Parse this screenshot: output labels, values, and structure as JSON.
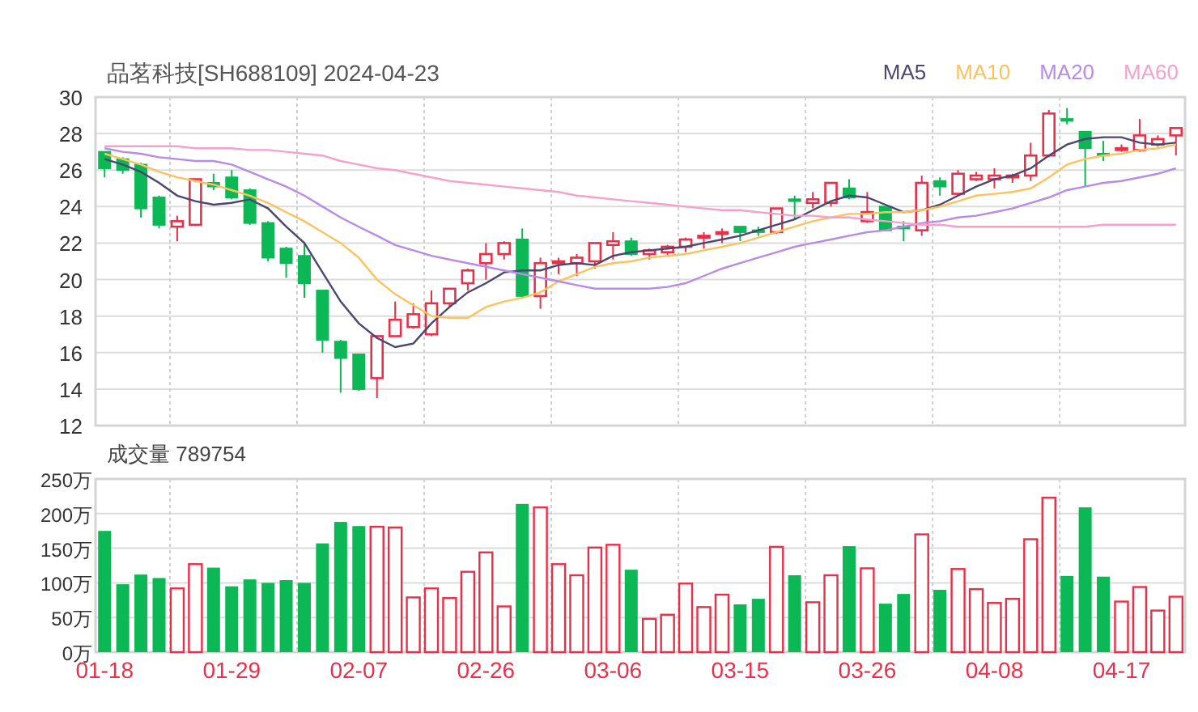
{
  "price": {
    "chart_data": {
      "type": "candlestick",
      "title": "品茗科技[SH688109] 2024-04-23",
      "ylim": [
        12,
        30
      ],
      "yticks": [
        12,
        14,
        16,
        18,
        20,
        22,
        24,
        26,
        28,
        30
      ],
      "grid": true,
      "ohlc": [
        [
          27.0,
          27.0,
          25.6,
          26.1
        ],
        [
          26.6,
          26.7,
          25.8,
          26.0
        ],
        [
          26.3,
          26.4,
          23.4,
          23.9
        ],
        [
          24.5,
          24.6,
          22.8,
          23.0
        ],
        [
          22.9,
          23.5,
          22.1,
          23.2
        ],
        [
          23.0,
          25.5,
          23.0,
          25.5
        ],
        [
          25.3,
          25.8,
          24.9,
          25.1
        ],
        [
          25.6,
          26.0,
          24.4,
          24.5
        ],
        [
          24.9,
          25.0,
          23.0,
          23.1
        ],
        [
          23.1,
          23.2,
          21.0,
          21.2
        ],
        [
          21.7,
          21.8,
          20.1,
          20.9
        ],
        [
          21.3,
          22.0,
          19.0,
          19.8
        ],
        [
          19.4,
          19.4,
          16.0,
          16.7
        ],
        [
          16.6,
          16.7,
          13.8,
          15.7
        ],
        [
          15.9,
          15.9,
          13.9,
          14.0
        ],
        [
          14.6,
          16.9,
          13.5,
          16.9
        ],
        [
          16.9,
          18.8,
          16.9,
          17.8
        ],
        [
          17.4,
          18.7,
          17.3,
          18.1
        ],
        [
          17.0,
          19.4,
          16.9,
          18.7
        ],
        [
          18.7,
          19.5,
          18.5,
          19.5
        ],
        [
          19.8,
          20.6,
          19.4,
          20.5
        ],
        [
          20.9,
          22.0,
          20.0,
          21.4
        ],
        [
          21.4,
          22.1,
          21.1,
          22.0
        ],
        [
          22.2,
          22.8,
          19.0,
          19.1
        ],
        [
          19.1,
          21.2,
          18.4,
          20.9
        ],
        [
          20.9,
          21.2,
          20.3,
          21.0
        ],
        [
          20.9,
          21.4,
          20.2,
          21.2
        ],
        [
          21.0,
          22.0,
          20.6,
          22.0
        ],
        [
          21.9,
          22.6,
          21.1,
          22.1
        ],
        [
          22.1,
          22.3,
          21.3,
          21.4
        ],
        [
          21.4,
          21.7,
          21.1,
          21.6
        ],
        [
          21.5,
          21.9,
          21.3,
          21.8
        ],
        [
          21.8,
          22.3,
          21.5,
          22.2
        ],
        [
          22.3,
          22.6,
          21.7,
          22.4
        ],
        [
          22.5,
          22.8,
          22.0,
          22.6
        ],
        [
          22.9,
          22.9,
          22.1,
          22.6
        ],
        [
          22.7,
          22.9,
          22.4,
          22.6
        ],
        [
          22.6,
          23.9,
          22.5,
          23.9
        ],
        [
          24.4,
          24.6,
          23.3,
          24.3
        ],
        [
          24.2,
          24.8,
          23.9,
          24.4
        ],
        [
          24.2,
          25.3,
          24.0,
          25.3
        ],
        [
          25.0,
          25.5,
          24.4,
          24.5
        ],
        [
          23.2,
          24.8,
          23.1,
          23.7
        ],
        [
          24.0,
          24.0,
          22.7,
          22.7
        ],
        [
          22.9,
          23.2,
          22.1,
          22.8
        ],
        [
          22.7,
          25.7,
          22.4,
          25.3
        ],
        [
          25.4,
          25.6,
          24.6,
          25.1
        ],
        [
          24.7,
          26.0,
          24.6,
          25.8
        ],
        [
          25.5,
          25.9,
          25.4,
          25.7
        ],
        [
          25.5,
          26.1,
          25.0,
          25.7
        ],
        [
          25.6,
          25.8,
          25.3,
          25.7
        ],
        [
          25.7,
          27.5,
          25.4,
          26.8
        ],
        [
          26.8,
          29.3,
          26.7,
          29.1
        ],
        [
          28.8,
          29.4,
          28.5,
          28.7
        ],
        [
          28.1,
          28.1,
          25.1,
          27.2
        ],
        [
          26.9,
          27.6,
          26.5,
          26.8
        ],
        [
          27.1,
          27.4,
          27.0,
          27.2
        ],
        [
          27.1,
          28.8,
          27.0,
          27.9
        ],
        [
          27.4,
          27.9,
          27.3,
          27.7
        ],
        [
          27.9,
          28.3,
          26.8,
          28.3
        ]
      ]
    }
  },
  "moving_averages": {
    "chart_data": {
      "type": "line",
      "ylim": [
        12,
        30
      ],
      "series": [
        {
          "name": "MA5",
          "color": "#4a4870",
          "values": [
            26.6,
            26.3,
            25.9,
            25.3,
            24.6,
            24.3,
            24.1,
            24.2,
            24.4,
            23.9,
            22.9,
            22.0,
            20.4,
            18.8,
            17.6,
            16.8,
            16.3,
            16.5,
            17.6,
            18.5,
            19.3,
            19.8,
            20.4,
            20.5,
            20.5,
            20.8,
            20.9,
            20.8,
            21.3,
            21.5,
            21.6,
            21.7,
            21.8,
            22.0,
            22.2,
            22.4,
            22.7,
            23.0,
            23.3,
            23.8,
            24.3,
            24.6,
            24.5,
            24.1,
            23.7,
            23.8,
            24.1,
            24.6,
            25.1,
            25.5,
            25.7,
            26.1,
            26.8,
            27.4,
            27.7,
            27.8,
            27.8,
            27.5,
            27.4,
            27.5
          ]
        },
        {
          "name": "MA10",
          "color": "#fcc25e",
          "values": [
            26.9,
            26.6,
            26.3,
            25.9,
            25.6,
            25.4,
            25.2,
            24.9,
            24.6,
            24.2,
            23.7,
            23.2,
            22.6,
            22.0,
            21.2,
            20.0,
            19.2,
            18.6,
            18.0,
            17.9,
            17.9,
            18.5,
            18.8,
            19.0,
            19.3,
            19.9,
            20.3,
            20.7,
            20.9,
            21.0,
            21.2,
            21.3,
            21.4,
            21.6,
            21.8,
            22.0,
            22.3,
            22.6,
            22.9,
            23.2,
            23.4,
            23.6,
            23.6,
            23.7,
            23.7,
            23.8,
            24.0,
            24.3,
            24.6,
            24.7,
            24.8,
            25.0,
            25.6,
            26.3,
            26.6,
            26.8,
            26.9,
            27.1,
            27.2,
            27.4
          ]
        },
        {
          "name": "MA20",
          "color": "#b98ae8",
          "values": [
            27.2,
            27.0,
            26.9,
            26.7,
            26.6,
            26.5,
            26.5,
            26.3,
            25.9,
            25.5,
            25.1,
            24.6,
            24.0,
            23.4,
            22.9,
            22.4,
            21.9,
            21.6,
            21.3,
            21.1,
            20.9,
            20.7,
            20.5,
            20.3,
            20.1,
            19.9,
            19.7,
            19.5,
            19.5,
            19.5,
            19.5,
            19.6,
            19.8,
            20.2,
            20.6,
            20.9,
            21.2,
            21.5,
            21.8,
            22.0,
            22.2,
            22.4,
            22.6,
            22.7,
            22.9,
            23.1,
            23.2,
            23.4,
            23.5,
            23.7,
            23.9,
            24.2,
            24.5,
            24.9,
            25.1,
            25.3,
            25.4,
            25.6,
            25.8,
            26.1
          ]
        },
        {
          "name": "MA60",
          "color": "#f8a0cc",
          "values": [
            27.3,
            27.3,
            27.3,
            27.3,
            27.3,
            27.2,
            27.2,
            27.2,
            27.1,
            27.1,
            27.0,
            26.9,
            26.8,
            26.5,
            26.3,
            26.1,
            26.0,
            25.8,
            25.6,
            25.4,
            25.3,
            25.2,
            25.1,
            25.0,
            24.9,
            24.8,
            24.6,
            24.5,
            24.4,
            24.3,
            24.2,
            24.1,
            24.0,
            23.9,
            23.8,
            23.8,
            23.7,
            23.6,
            23.5,
            23.5,
            23.4,
            23.4,
            23.3,
            23.2,
            23.1,
            23.0,
            23.0,
            22.9,
            22.9,
            22.9,
            22.9,
            22.9,
            22.9,
            22.9,
            22.9,
            23.0,
            23.0,
            23.0,
            23.0,
            23.0
          ]
        }
      ]
    }
  },
  "volume": {
    "chart_data": {
      "type": "bar",
      "title": "成交量 789754",
      "ylim": [
        0,
        250
      ],
      "grid": true,
      "yticks": [
        {
          "value": 0,
          "label": "0万"
        },
        {
          "value": 50,
          "label": "50万"
        },
        {
          "value": 100,
          "label": "100万"
        },
        {
          "value": 150,
          "label": "150万"
        },
        {
          "value": 200,
          "label": "200万"
        },
        {
          "value": 250,
          "label": "250万"
        }
      ],
      "categories": [
        "01-18",
        null,
        null,
        null,
        null,
        null,
        null,
        "01-29",
        null,
        null,
        null,
        null,
        null,
        null,
        "02-07",
        null,
        null,
        null,
        null,
        null,
        null,
        "02-26",
        null,
        null,
        null,
        null,
        null,
        null,
        "03-06",
        null,
        null,
        null,
        null,
        null,
        null,
        "03-15",
        null,
        null,
        null,
        null,
        null,
        null,
        "03-26",
        null,
        null,
        null,
        null,
        null,
        null,
        "04-08",
        null,
        null,
        null,
        null,
        null,
        null,
        "04-17",
        null,
        null,
        null
      ],
      "series": [
        {
          "values": [
            175,
            98,
            112,
            107,
            92,
            127,
            122,
            95,
            105,
            100,
            104,
            100,
            157,
            188,
            182,
            181,
            180,
            79,
            92,
            78,
            116,
            144,
            66,
            214,
            209,
            127,
            111,
            151,
            155,
            119,
            48,
            54,
            99,
            65,
            83,
            69,
            77,
            152,
            111,
            72,
            111,
            153,
            121,
            70,
            84,
            170,
            90,
            120,
            91,
            71,
            77,
            163,
            223,
            110,
            209,
            109,
            73,
            94,
            60,
            80
          ]
        }
      ]
    }
  }
}
